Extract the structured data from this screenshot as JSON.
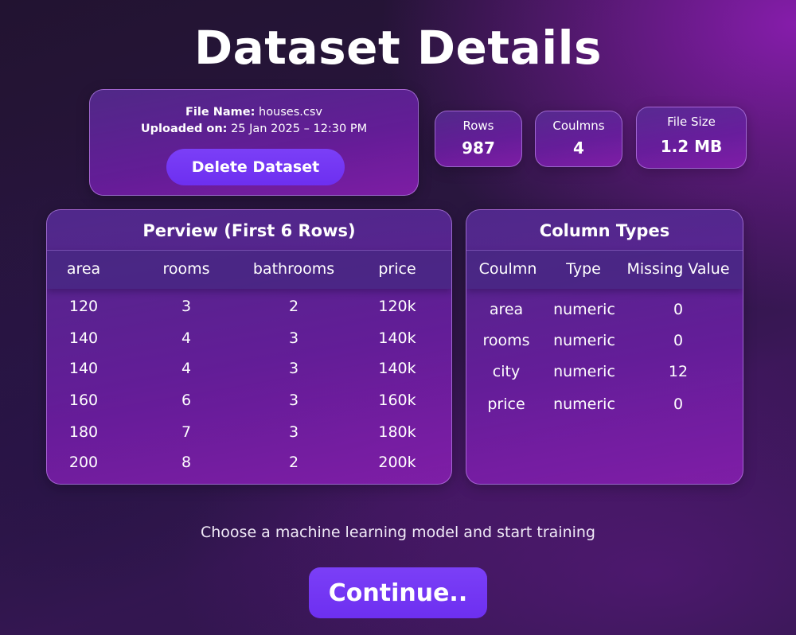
{
  "page": {
    "title": "Dataset Details"
  },
  "file": {
    "name_label": "File Name:",
    "name_value": "houses.csv",
    "uploaded_label": "Uploaded on:",
    "uploaded_value": "25 Jan 2025 – 12:30 PM",
    "delete_label": "Delete Dataset"
  },
  "stats": [
    {
      "label": "Rows",
      "value": "987"
    },
    {
      "label": "Coulmns",
      "value": "4"
    },
    {
      "label": "File Size",
      "value": "1.2 MB"
    }
  ],
  "preview": {
    "title": "Perview (First 6 Rows)",
    "columns": [
      "area",
      "rooms",
      "bathrooms",
      "price"
    ],
    "rows": [
      [
        "120",
        "3",
        "2",
        "120k"
      ],
      [
        "140",
        "4",
        "3",
        "140k"
      ],
      [
        "140",
        "4",
        "3",
        "140k"
      ],
      [
        "160",
        "6",
        "3",
        "160k"
      ],
      [
        "180",
        "7",
        "3",
        "180k"
      ],
      [
        "200",
        "8",
        "2",
        "200k"
      ]
    ]
  },
  "column_types": {
    "title": "Column Types",
    "columns": [
      "Coulmn",
      "Type",
      "Missing Value"
    ],
    "rows": [
      [
        "area",
        "numeric",
        "0"
      ],
      [
        "rooms",
        "numeric",
        "0"
      ],
      [
        "city",
        "numeric",
        "12"
      ],
      [
        "price",
        "numeric",
        "0"
      ]
    ]
  },
  "footer": {
    "caption": "Choose a machine learning model and start training",
    "continue_label": "Continue.."
  }
}
